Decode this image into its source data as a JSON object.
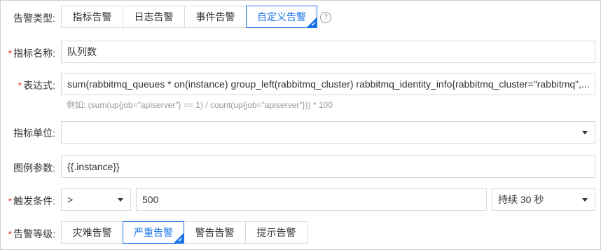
{
  "alert_type": {
    "label": "告警类型:",
    "options": [
      "指标告警",
      "日志告警",
      "事件告警",
      "自定义告警"
    ],
    "selected": "自定义告警",
    "help_icon": "question-circle-icon"
  },
  "metric_name": {
    "required_mark": "*",
    "label": "指标名称:",
    "value": "队列数"
  },
  "expression": {
    "required_mark": "*",
    "label": "表达式:",
    "value": "sum(rabbitmq_queues * on(instance) group_left(rabbitmq_cluster) rabbitmq_identity_info{rabbitmq_cluster=\"rabbitmq\",...",
    "hint": "例如:  (sum(up{job=\"apiserver\"} == 1) / count(up{job=\"apiserver\"})) * 100"
  },
  "metric_unit": {
    "label": "指标单位:",
    "value": ""
  },
  "legend_param": {
    "label": "图例参数:",
    "value": "{{.instance}}"
  },
  "trigger": {
    "required_mark": "*",
    "label": "触发条件:",
    "operator": ">",
    "threshold": "500",
    "duration": "持续 30 秒"
  },
  "alert_level": {
    "required_mark": "*",
    "label": "告警等级:",
    "options": [
      "灾难告警",
      "严重告警",
      "警告告警",
      "提示告警"
    ],
    "selected": "严重告警"
  },
  "colors": {
    "accent": "#1a73e8",
    "required": "#e53935",
    "border": "#d9d9d9"
  }
}
